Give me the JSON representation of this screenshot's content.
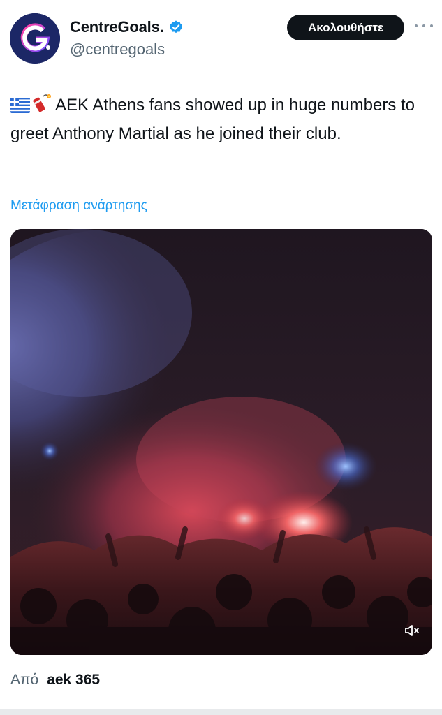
{
  "author": {
    "display_name": "CentreGoals.",
    "handle": "@centregoals",
    "avatar_letter": "G",
    "verified": true
  },
  "follow_button": {
    "label": "Ακολουθήστε"
  },
  "tweet": {
    "emojis": [
      "greek-flag-icon",
      "firecracker-icon"
    ],
    "text": "AEK Athens fans showed up in huge numbers to greet Anthony Martial as he joined their club.",
    "translate_label": "Μετάφραση ανάρτησης"
  },
  "media": {
    "type": "video",
    "muted": true
  },
  "source": {
    "prefix": "Από",
    "name": "aek 365"
  },
  "colors": {
    "link": "#1d9bf0",
    "verified": "#1d9bf0",
    "button_bg": "#0f1419",
    "secondary_text": "#536471"
  }
}
